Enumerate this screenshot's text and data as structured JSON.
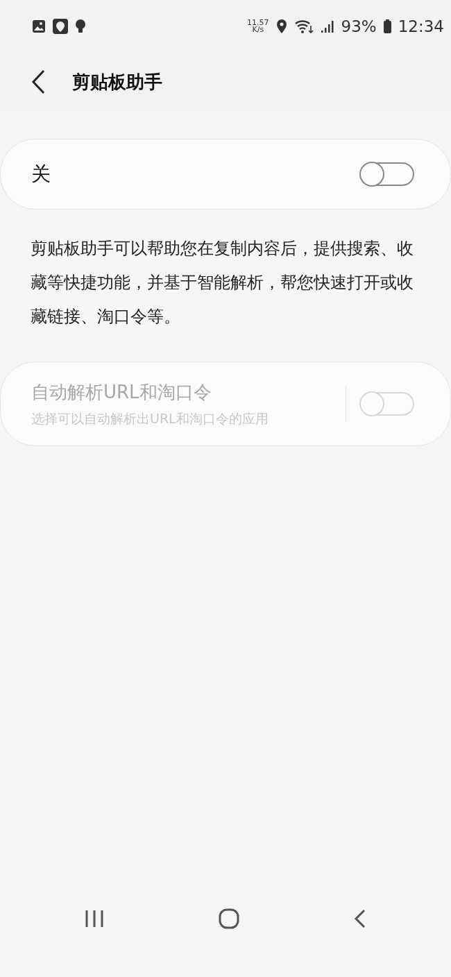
{
  "status_bar": {
    "net_speed": "11.57",
    "net_unit": "K/s",
    "battery": "93%",
    "time": "12:34"
  },
  "header": {
    "title": "剪贴板助手"
  },
  "main_switch": {
    "label": "关",
    "on": false
  },
  "description": "剪贴板助手可以帮助您在复制内容后，提供搜索、收藏等快捷功能，并基于智能解析，帮您快速打开或收藏链接、淘口令等。",
  "auto_parse": {
    "title": "自动解析URL和淘口令",
    "subtitle": "选择可以自动解析出URL和淘口令的应用",
    "on": false,
    "disabled": true
  }
}
